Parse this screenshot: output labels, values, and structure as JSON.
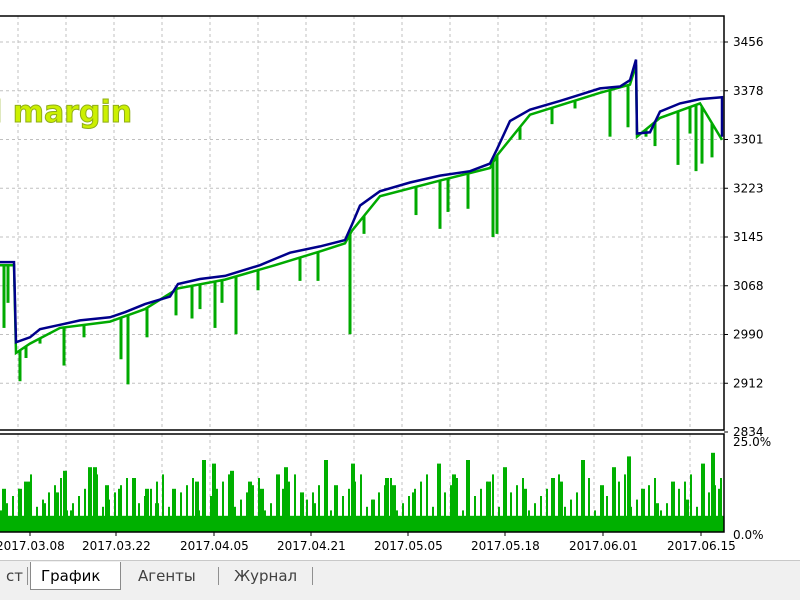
{
  "overlay_label": "l margin",
  "tabs": [
    {
      "label": "ст",
      "active": false
    },
    {
      "label": "График",
      "active": true
    },
    {
      "label": "Агенты",
      "active": false
    },
    {
      "label": "Журнал",
      "active": false
    }
  ],
  "colors": {
    "balance": "#00008b",
    "equity": "#00aa00",
    "load": "#00b000",
    "grid": "#c0c0c0",
    "frame": "#000000"
  },
  "chart_data": [
    {
      "type": "line",
      "ylim": [
        2834,
        3456
      ],
      "ytick_labels": [
        "3456",
        "3378",
        "3301",
        "3223",
        "3145",
        "3068",
        "2990",
        "2912",
        "2834"
      ],
      "series": [
        {
          "points": [
            [
              0,
              3105
            ],
            [
              14,
              3105
            ],
            [
              16,
              2977
            ],
            [
              30,
              2985
            ],
            [
              40,
              2998
            ],
            [
              60,
              3005
            ],
            [
              80,
              3012
            ],
            [
              110,
              3017
            ],
            [
              125,
              3025
            ],
            [
              145,
              3038
            ],
            [
              170,
              3050
            ],
            [
              178,
              3070
            ],
            [
              200,
              3078
            ],
            [
              225,
              3083
            ],
            [
              260,
              3100
            ],
            [
              275,
              3110
            ],
            [
              290,
              3120
            ],
            [
              320,
              3130
            ],
            [
              345,
              3140
            ],
            [
              352,
              3165
            ],
            [
              360,
              3195
            ],
            [
              380,
              3218
            ],
            [
              410,
              3232
            ],
            [
              440,
              3243
            ],
            [
              470,
              3250
            ],
            [
              490,
              3262
            ],
            [
              497,
              3285
            ],
            [
              510,
              3330
            ],
            [
              530,
              3348
            ],
            [
              560,
              3362
            ],
            [
              580,
              3372
            ],
            [
              600,
              3382
            ],
            [
              620,
              3385
            ],
            [
              630,
              3395
            ],
            [
              636,
              3428
            ],
            [
              637,
              3310
            ],
            [
              650,
              3312
            ],
            [
              660,
              3345
            ],
            [
              680,
              3358
            ],
            [
              700,
              3365
            ],
            [
              722,
              3368
            ],
            [
              722,
              3305
            ]
          ]
        },
        {
          "points": [
            [
              0,
              3100
            ],
            [
              14,
              3100
            ],
            [
              16,
              2960
            ],
            [
              30,
              2975
            ],
            [
              60,
              3000
            ],
            [
              110,
              3010
            ],
            [
              145,
              3030
            ],
            [
              178,
              3063
            ],
            [
              225,
              3077
            ],
            [
              275,
              3100
            ],
            [
              320,
              3122
            ],
            [
              345,
              3135
            ],
            [
              352,
              3155
            ],
            [
              380,
              3210
            ],
            [
              440,
              3235
            ],
            [
              490,
              3255
            ],
            [
              497,
              3275
            ],
            [
              530,
              3340
            ],
            [
              600,
              3375
            ],
            [
              630,
              3388
            ],
            [
              636,
              3420
            ],
            [
              637,
              3305
            ],
            [
              660,
              3335
            ],
            [
              700,
              3358
            ],
            [
              722,
              3300
            ]
          ],
          "drops": [
            [
              4,
              3000
            ],
            [
              8,
              3040
            ],
            [
              20,
              2915
            ],
            [
              26,
              2952
            ],
            [
              40,
              2975
            ],
            [
              64,
              2940
            ],
            [
              84,
              2985
            ],
            [
              121,
              2950
            ],
            [
              128,
              2910
            ],
            [
              147,
              2985
            ],
            [
              176,
              3020
            ],
            [
              192,
              3015
            ],
            [
              200,
              3030
            ],
            [
              215,
              3000
            ],
            [
              222,
              3040
            ],
            [
              236,
              2990
            ],
            [
              258,
              3060
            ],
            [
              300,
              3075
            ],
            [
              318,
              3075
            ],
            [
              350,
              2990
            ],
            [
              364,
              3150
            ],
            [
              416,
              3180
            ],
            [
              440,
              3158
            ],
            [
              448,
              3185
            ],
            [
              468,
              3190
            ],
            [
              493,
              3145
            ],
            [
              497,
              3150
            ],
            [
              520,
              3300
            ],
            [
              552,
              3325
            ],
            [
              575,
              3350
            ],
            [
              610,
              3305
            ],
            [
              628,
              3320
            ],
            [
              646,
              3305
            ],
            [
              655,
              3290
            ],
            [
              678,
              3260
            ],
            [
              690,
              3310
            ],
            [
              696,
              3250
            ],
            [
              702,
              3262
            ],
            [
              712,
              3272
            ]
          ]
        }
      ]
    },
    {
      "type": "bar",
      "ylim": [
        0,
        25
      ],
      "ytick_labels": [
        "25.0%",
        "0.0%"
      ],
      "x_tick_labels": [
        "2017.03.08",
        "2017.03.22",
        "2017.04.05",
        "2017.04.21",
        "2017.05.05",
        "2017.05.18",
        "2017.06.01",
        "2017.06.15"
      ],
      "baseline_percent": 4.5,
      "spikes": [
        [
          2,
          12
        ],
        [
          18,
          12
        ],
        [
          26,
          14
        ],
        [
          42,
          8
        ],
        [
          55,
          11
        ],
        [
          63,
          17
        ],
        [
          70,
          6
        ],
        [
          88,
          18
        ],
        [
          93,
          18
        ],
        [
          105,
          13
        ],
        [
          118,
          12
        ],
        [
          132,
          15
        ],
        [
          145,
          12
        ],
        [
          155,
          8
        ],
        [
          172,
          12
        ],
        [
          195,
          14
        ],
        [
          202,
          20
        ],
        [
          212,
          19
        ],
        [
          230,
          17
        ],
        [
          248,
          14
        ],
        [
          260,
          12
        ],
        [
          276,
          16
        ],
        [
          284,
          18
        ],
        [
          300,
          11
        ],
        [
          312,
          8
        ],
        [
          324,
          20
        ],
        [
          334,
          13
        ],
        [
          351,
          19
        ],
        [
          371,
          9
        ],
        [
          385,
          15
        ],
        [
          392,
          13
        ],
        [
          412,
          11
        ],
        [
          437,
          19
        ],
        [
          452,
          16
        ],
        [
          466,
          20
        ],
        [
          487,
          14
        ],
        [
          503,
          18
        ],
        [
          523,
          12
        ],
        [
          551,
          15
        ],
        [
          559,
          14
        ],
        [
          581,
          20
        ],
        [
          600,
          13
        ],
        [
          612,
          18
        ],
        [
          627,
          21
        ],
        [
          641,
          12
        ],
        [
          655,
          8
        ],
        [
          671,
          14
        ],
        [
          685,
          9
        ],
        [
          701,
          19
        ],
        [
          711,
          22
        ],
        [
          718,
          12
        ]
      ]
    }
  ]
}
